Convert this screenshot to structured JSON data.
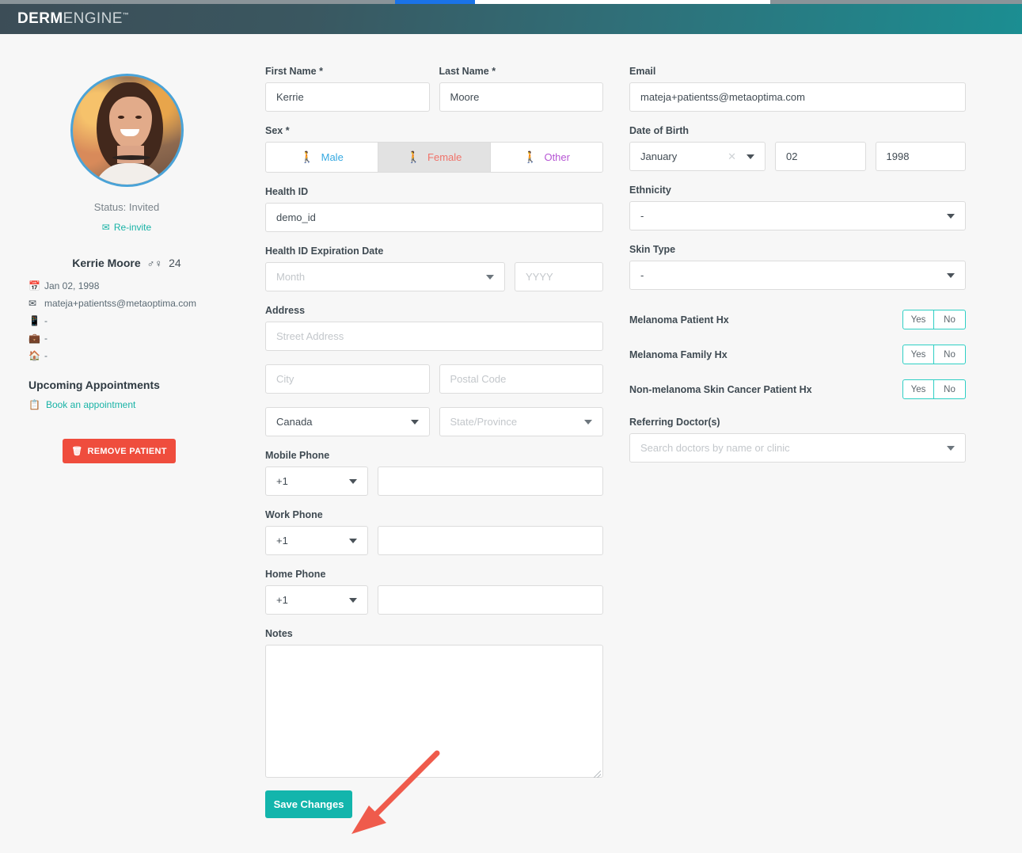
{
  "header": {
    "logo_bold": "DERM",
    "logo_light": "ENGINE",
    "logo_tm": "™"
  },
  "sidebar": {
    "status_text": "Status: Invited",
    "reinvite_label": "Re-invite",
    "patient_name": "Kerrie Moore",
    "age": "24",
    "info_rows": [
      {
        "icon": "calendar-icon",
        "glyph": "▤",
        "value": "Jan 02, 1998"
      },
      {
        "icon": "envelope-icon",
        "glyph": "✉",
        "value": "mateja+patientss@metaoptima.com"
      },
      {
        "icon": "mobile-phone-icon",
        "glyph": "⎕",
        "value": "-"
      },
      {
        "icon": "briefcase-icon",
        "glyph": "■",
        "value": "-"
      },
      {
        "icon": "home-icon",
        "glyph": "⌂",
        "value": "-"
      }
    ],
    "upcoming_title": "Upcoming Appointments",
    "book_appointment_label": "Book an appointment",
    "remove_patient_label": "REMOVE PATIENT"
  },
  "form": {
    "first_name": {
      "label": "First Name *",
      "value": "Kerrie"
    },
    "last_name": {
      "label": "Last Name *",
      "value": "Moore"
    },
    "email": {
      "label": "Email",
      "value": "mateja+patientss@metaoptima.com"
    },
    "sex": {
      "label": "Sex *",
      "options": [
        {
          "label": "Male",
          "color": "#36a9e1",
          "selected": false
        },
        {
          "label": "Female",
          "color": "#f0736a",
          "selected": true
        },
        {
          "label": "Other",
          "color": "#b656d4",
          "selected": false
        }
      ]
    },
    "dob": {
      "label": "Date of Birth",
      "month": "January",
      "day": "02",
      "year": "1998"
    },
    "health_id": {
      "label": "Health ID",
      "value": "demo_id"
    },
    "health_id_exp": {
      "label": "Health ID Expiration Date",
      "month_placeholder": "Month",
      "year_placeholder": "YYYY"
    },
    "ethnicity": {
      "label": "Ethnicity",
      "value": "-"
    },
    "skin_type": {
      "label": "Skin Type",
      "value": "-"
    },
    "address": {
      "label": "Address",
      "street_placeholder": "Street Address",
      "city_placeholder": "City",
      "postal_placeholder": "Postal Code",
      "country": "Canada",
      "state_placeholder": "State/Province"
    },
    "history": [
      {
        "label": "Melanoma Patient Hx",
        "yes": "Yes",
        "no": "No"
      },
      {
        "label": "Melanoma Family Hx",
        "yes": "Yes",
        "no": "No"
      },
      {
        "label": "Non-melanoma Skin Cancer Patient Hx",
        "yes": "Yes",
        "no": "No"
      }
    ],
    "referring_doctors": {
      "label": "Referring Doctor(s)",
      "placeholder": "Search doctors by name or clinic"
    },
    "mobile_phone": {
      "label": "Mobile Phone",
      "code": "+1",
      "value": ""
    },
    "work_phone": {
      "label": "Work Phone",
      "code": "+1",
      "value": ""
    },
    "home_phone": {
      "label": "Home Phone",
      "code": "+1",
      "value": ""
    },
    "notes": {
      "label": "Notes",
      "value": ""
    },
    "save_label": "Save Changes"
  },
  "colors": {
    "teal": "#13b5ac",
    "toggle_border": "#2ecfc4",
    "danger": "#ef4d3d",
    "annotation_arrow": "#ef5b4c"
  }
}
